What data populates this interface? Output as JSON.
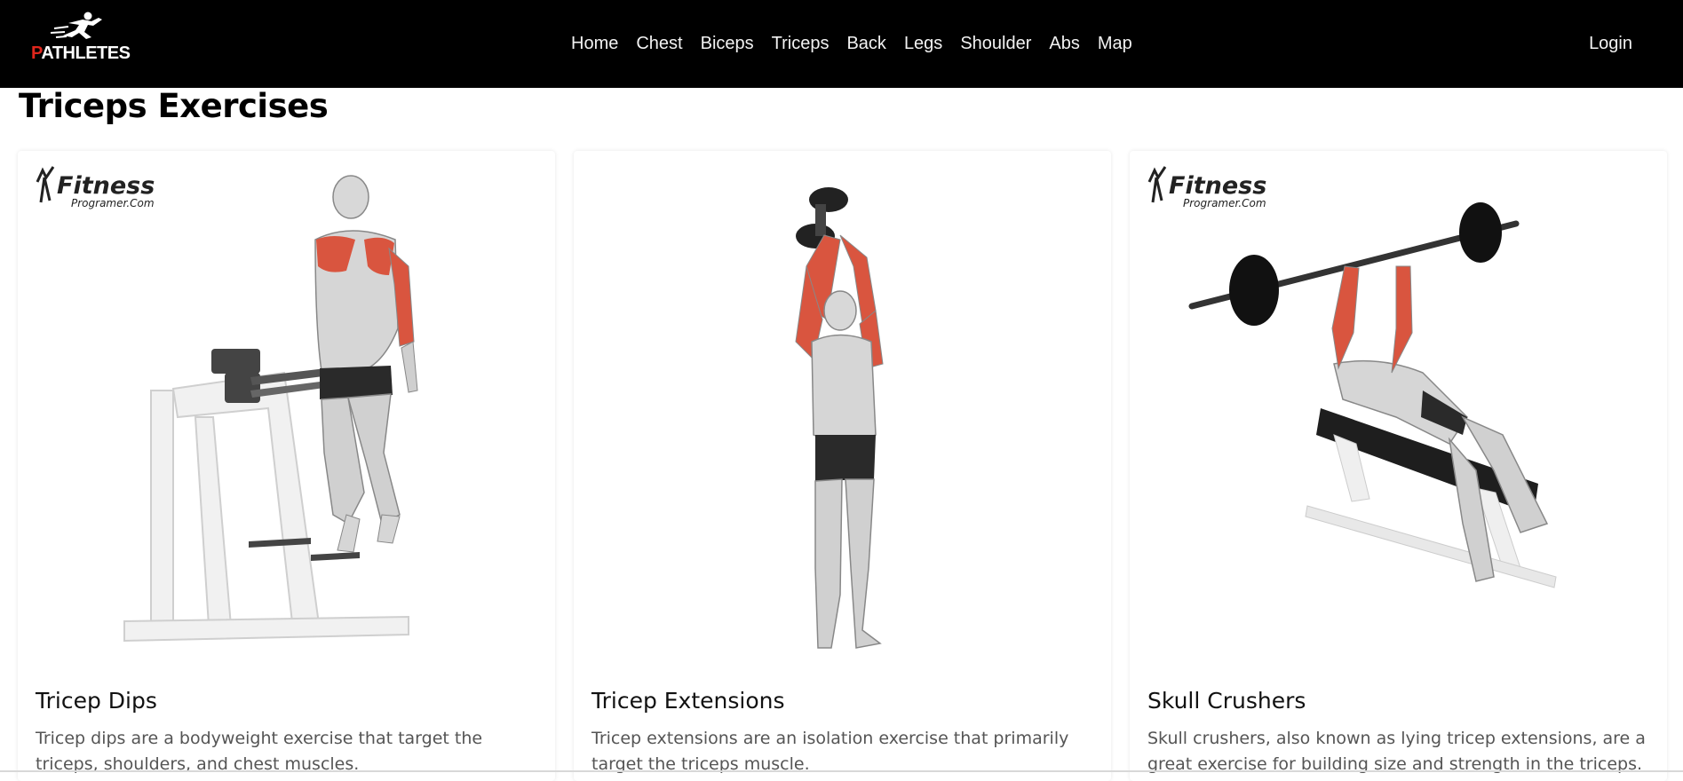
{
  "brand": {
    "text_first": "P",
    "text_rest": "ATHLETES",
    "accent": "#e0261c"
  },
  "nav": {
    "items": [
      "Home",
      "Chest",
      "Biceps",
      "Triceps",
      "Back",
      "Legs",
      "Shoulder",
      "Abs",
      "Map"
    ],
    "login_label": "Login"
  },
  "page": {
    "title": "Triceps Exercises"
  },
  "watermark": {
    "main": "Fitness",
    "sub": "Programer.Com"
  },
  "cards": [
    {
      "title": "Tricep Dips",
      "description": "Tricep dips are a bodyweight exercise that target the triceps, shoulders, and chest muscles.",
      "has_watermark": true
    },
    {
      "title": "Tricep Extensions",
      "description": "Tricep extensions are an isolation exercise that primarily target the triceps muscle.",
      "has_watermark": false
    },
    {
      "title": "Skull Crushers",
      "description": "Skull crushers, also known as lying tricep extensions, are a great exercise for building size and strength in the triceps.",
      "has_watermark": true
    }
  ],
  "colors": {
    "navbar_bg": "#000000",
    "muscle_highlight": "#d9553f",
    "body_gray": "#cfcfcf"
  }
}
